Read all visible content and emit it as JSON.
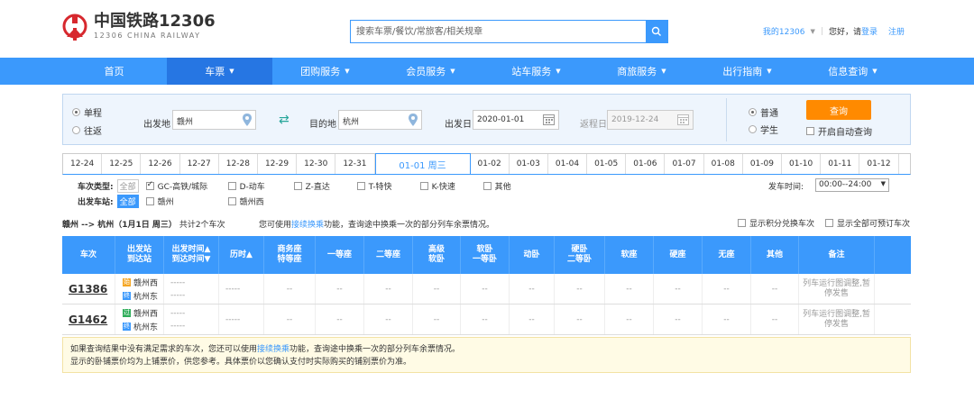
{
  "header": {
    "logo_cn": "中国铁路12306",
    "logo_en": "12306 CHINA RAILWAY",
    "search_placeholder": "搜索车票/餐饮/常旅客/相关规章",
    "my_account": "我的12306",
    "greeting": "您好，请",
    "login": "登录",
    "register": "注册"
  },
  "nav": [
    {
      "label": "首页",
      "dropdown": false
    },
    {
      "label": "车票",
      "dropdown": true,
      "active": true
    },
    {
      "label": "团购服务",
      "dropdown": true
    },
    {
      "label": "会员服务",
      "dropdown": true
    },
    {
      "label": "站车服务",
      "dropdown": true
    },
    {
      "label": "商旅服务",
      "dropdown": true
    },
    {
      "label": "出行指南",
      "dropdown": true
    },
    {
      "label": "信息查询",
      "dropdown": true
    }
  ],
  "query": {
    "one_way": "单程",
    "round_trip": "往返",
    "from_label": "出发地",
    "from_value": "赣州",
    "to_label": "目的地",
    "to_value": "杭州",
    "depart_label": "出发日",
    "depart_value": "2020-01-01",
    "return_label": "返程日",
    "return_value": "2019-12-24",
    "normal": "普通",
    "student": "学生",
    "query_button": "查询",
    "auto_query": "开启自动查询"
  },
  "dates": [
    "12-24",
    "12-25",
    "12-26",
    "12-27",
    "12-28",
    "12-29",
    "12-30",
    "12-31",
    "01-01 周三",
    "01-02",
    "01-03",
    "01-04",
    "01-05",
    "01-06",
    "01-07",
    "01-08",
    "01-09",
    "01-10",
    "01-11",
    "01-12"
  ],
  "active_date_index": 8,
  "filters": {
    "type_label": "车次类型:",
    "all": "全部",
    "types": [
      {
        "label": "GC-高铁/城际",
        "checked": true
      },
      {
        "label": "D-动车",
        "checked": false
      },
      {
        "label": "Z-直达",
        "checked": false
      },
      {
        "label": "T-特快",
        "checked": false
      },
      {
        "label": "K-快速",
        "checked": false
      },
      {
        "label": "其他",
        "checked": false
      }
    ],
    "station_label": "出发车站:",
    "stations": [
      "赣州",
      "赣州西"
    ],
    "time_label": "发车时间:",
    "time_value": "00:00--24:00"
  },
  "summary": {
    "route": "赣州 --> 杭州（1月1日 周三）",
    "count": "共计2个车次",
    "hint_pre": "您可使用",
    "hint_link": "接续换乘",
    "hint_post": "功能，查询途中换乘一次的部分列车余票情况。",
    "opt_points": "显示积分兑换车次",
    "opt_all": "显示全部可预订车次"
  },
  "table": {
    "headers": [
      "车次",
      "出发站\n到达站",
      "出发时间▲\n到达时间▼",
      "历时▲",
      "商务座\n特等座",
      "一等座",
      "二等座",
      "高级\n软卧",
      "软卧\n一等卧",
      "动卧",
      "硬卧\n二等卧",
      "软座",
      "硬座",
      "无座",
      "其他",
      "备注"
    ],
    "rows": [
      {
        "train": "G1386",
        "from": "赣州西",
        "from_tag": "始",
        "to": "杭州东",
        "to_tag": "终",
        "depart": "-----",
        "arrive": "-----",
        "duration": "-----",
        "seats": [
          "--",
          "--",
          "--",
          "--",
          "--",
          "--",
          "--",
          "--",
          "--",
          "--",
          "--"
        ],
        "remark": "列车运行图调整,暂停发售"
      },
      {
        "train": "G1462",
        "from": "赣州西",
        "from_tag": "过",
        "to": "杭州东",
        "to_tag": "终",
        "depart": "-----",
        "arrive": "-----",
        "duration": "-----",
        "seats": [
          "--",
          "--",
          "--",
          "--",
          "--",
          "--",
          "--",
          "--",
          "--",
          "--",
          "--"
        ],
        "remark": "列车运行图调整,暂停发售"
      }
    ]
  },
  "notice": {
    "line1_pre": "如果查询结果中没有满足需求的车次，您还可以使用",
    "line1_link": "接续换乘",
    "line1_post": "功能，查询途中换乘一次的部分列车余票情况。",
    "line2": "显示的卧铺票价均为上铺票价，供您参考。具体票价以您确认支付时实际购买的铺别票价为准。"
  },
  "colors": {
    "brand_blue": "#3b99fc",
    "active_nav": "#2676e3",
    "query_orange": "#ff8a00",
    "logo_red": "#d7282e"
  }
}
